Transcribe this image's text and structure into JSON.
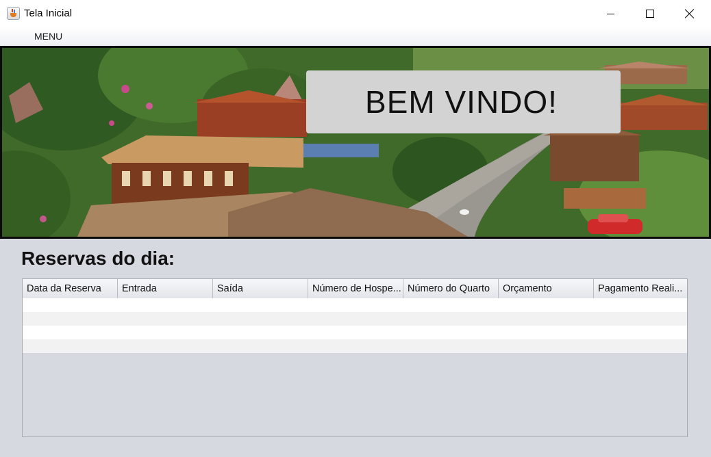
{
  "window": {
    "title": "Tela Inicial"
  },
  "menubar": {
    "items": [
      {
        "label": "MENU"
      }
    ]
  },
  "banner": {
    "welcome_text": "BEM VINDO!"
  },
  "reservations": {
    "title": "Reservas do dia:",
    "columns": [
      "Data da Reserva",
      "Entrada",
      "Saída",
      "Número de Hospe...",
      "Número do Quarto",
      "Orçamento",
      "Pagamento Reali..."
    ],
    "rows": [
      [
        "",
        "",
        "",
        "",
        "",
        "",
        ""
      ],
      [
        "",
        "",
        "",
        "",
        "",
        "",
        ""
      ],
      [
        "",
        "",
        "",
        "",
        "",
        "",
        ""
      ],
      [
        "",
        "",
        "",
        "",
        "",
        "",
        ""
      ]
    ]
  },
  "colors": {
    "window_bg": "#d6d9df",
    "banner_frame": "#0a0a0a",
    "welcome_box": "#d3d3d3"
  }
}
